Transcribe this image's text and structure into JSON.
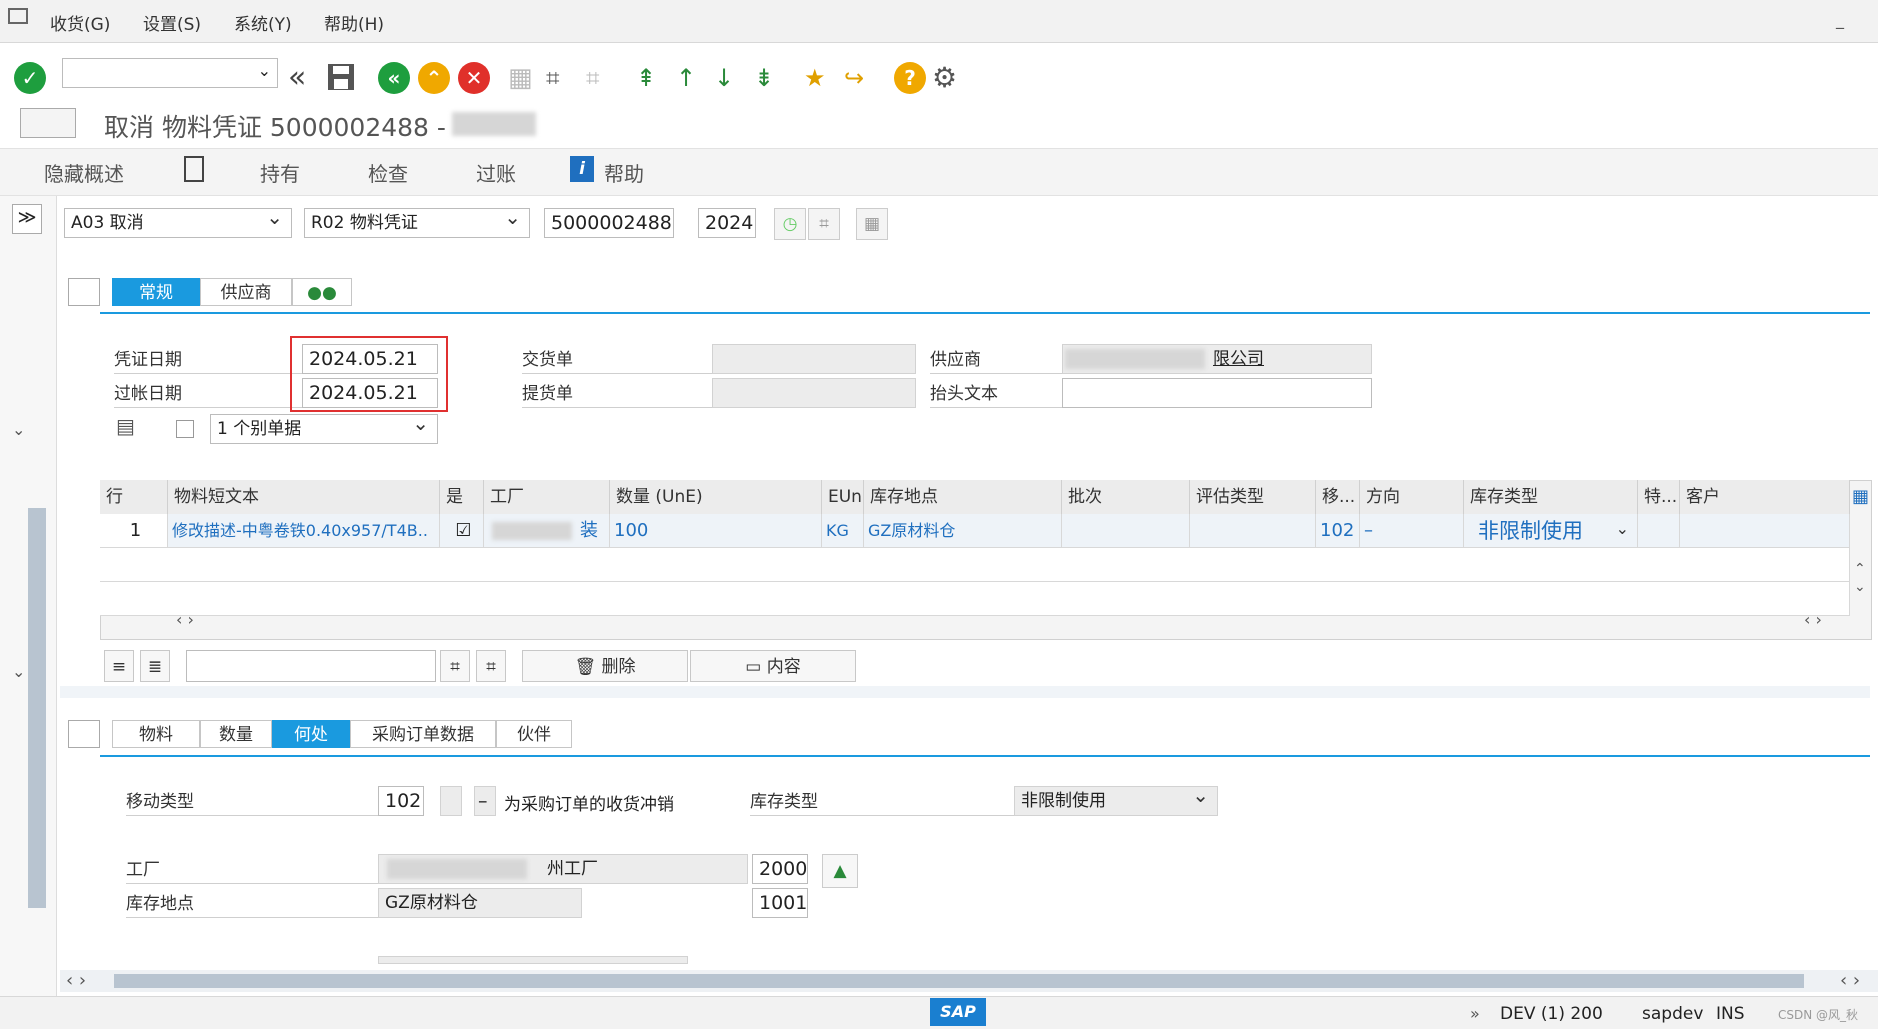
{
  "menu": [
    "收货(G)",
    "设置(S)",
    "系统(Y)",
    "帮助(H)"
  ],
  "title": "取消 物料凭证 5000002488 -",
  "app_toolbar": {
    "hide_overview": "隐藏概述",
    "hold": "持有",
    "check": "检查",
    "post": "过账",
    "help": "帮助"
  },
  "header": {
    "action": "A03 取消",
    "reference": "R02 物料凭证",
    "doc_number": "5000002488",
    "year": "2024"
  },
  "header_tabs": [
    "常规",
    "供应商"
  ],
  "general": {
    "doc_date_label": "凭证日期",
    "doc_date": "2024.05.21",
    "post_date_label": "过帐日期",
    "post_date": "2024.05.21",
    "delivery_note_label": "交货单",
    "bill_of_lading_label": "提货单",
    "vendor_label": "供应商",
    "vendor_value": "限公司",
    "header_text_label": "抬头文本",
    "print_option": "1 个别单据"
  },
  "grid": {
    "columns": [
      "行",
      "物料短文本",
      "是",
      "工厂",
      "数量 (UnE)",
      "EUn",
      "库存地点",
      "批次",
      "评估类型",
      "移...",
      "方向",
      "库存类型",
      "特...",
      "客户"
    ],
    "row": {
      "line": "1",
      "material_text": "修改描述-中粤卷铁0.40x957/T4B..",
      "plant": "装",
      "qty": "100",
      "unit": "KG",
      "storage": "GZ原材料仓",
      "movement": "102",
      "direction": "–",
      "stock_type": "非限制使用"
    }
  },
  "grid_toolbar": {
    "delete": "删除",
    "content": "内容"
  },
  "item_tabs": [
    "物料",
    "数量",
    "何处",
    "采购订单数据",
    "伙伴"
  ],
  "where": {
    "movement_type_label": "移动类型",
    "movement_type": "102",
    "movement_indicator": "–",
    "movement_text": "为采购订单的收货冲销",
    "stock_type_label": "库存类型",
    "stock_type": "非限制使用",
    "plant_label": "工厂",
    "plant_name": "州工厂",
    "plant_code": "2000",
    "storage_label": "库存地点",
    "storage_name": "GZ原材料仓",
    "storage_code": "1001"
  },
  "status": {
    "system": "DEV (1) 200",
    "user": "sapdev",
    "mode": "INS",
    "watermark": "CSDN @风_秋"
  }
}
